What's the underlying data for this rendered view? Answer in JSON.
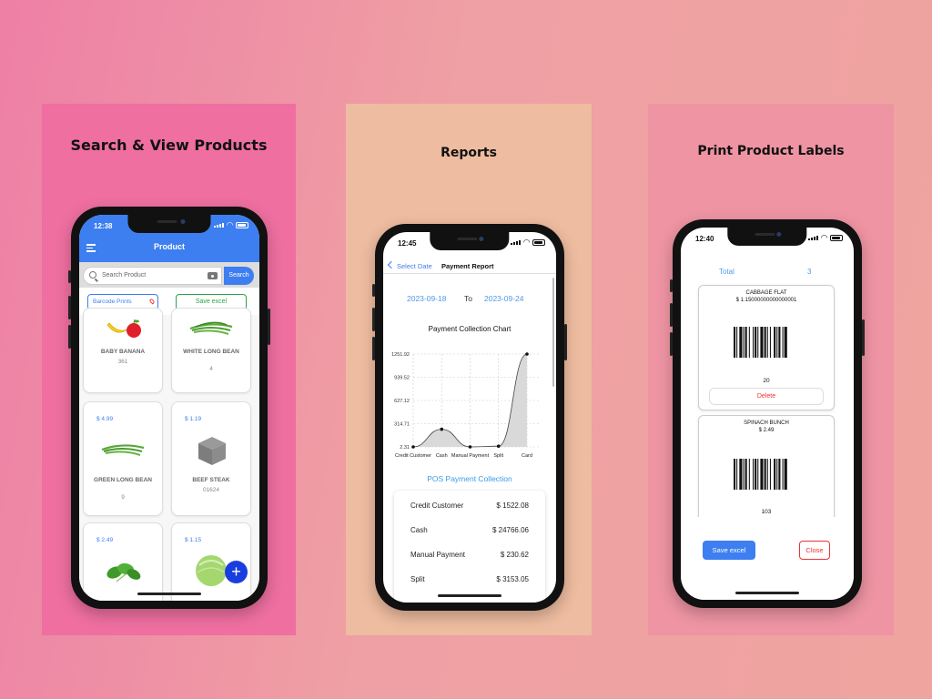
{
  "panels": {
    "search": {
      "title": "Search & View Products",
      "phone": {
        "time": "12:38",
        "header_title": "Product",
        "search_placeholder": "Search Product",
        "search_button": "Search",
        "barcode_prints": "Barcode Prints",
        "save_excel": "Save excel",
        "fab_label": "+",
        "products": [
          {
            "price": "",
            "name": "BABY BANANA",
            "code": "361",
            "image": "banana-apple"
          },
          {
            "price": "",
            "name": "WHITE LONG BEAN",
            "code": "4",
            "image": "long-bean"
          },
          {
            "price": "$ 4.99",
            "name": "GREEN LONG BEAN",
            "code": "9",
            "image": "long-bean"
          },
          {
            "price": "$ 1.19",
            "name": "BEEF STEAK",
            "code": "01624",
            "image": "box-placeholder"
          },
          {
            "price": "$ 2.49",
            "name": "",
            "code": "",
            "image": "spinach"
          },
          {
            "price": "$ 1.15",
            "name": "",
            "code": "",
            "image": "cabbage"
          }
        ]
      }
    },
    "reports": {
      "title": "Reports",
      "phone": {
        "time": "12:45",
        "back_label": "Select Date",
        "nav_title": "Payment Report",
        "date_from": "2023-09-18",
        "date_to_label": "To",
        "date_to": "2023-09-24",
        "chart_title": "Payment Collection Chart",
        "list_title": "POS Payment Collection",
        "rows": [
          {
            "label": "Credit Customer",
            "value": "$ 1522.08"
          },
          {
            "label": "Cash",
            "value": "$ 24766.06"
          },
          {
            "label": "Manual Payment",
            "value": "$ 230.62"
          },
          {
            "label": "Split",
            "value": "$ 3153.05"
          }
        ]
      }
    },
    "labels": {
      "title": "Print Product Labels",
      "phone": {
        "time": "12:40",
        "total_label": "Total",
        "total_value": "3",
        "cards": [
          {
            "name": "CABBAGE FLAT",
            "price": "$ 1.15000000000000001",
            "qty": "20",
            "delete": "Delete"
          },
          {
            "name": "SPINACH BUNCH",
            "price": "$ 2.49",
            "qty": "103",
            "delete": ""
          }
        ],
        "save_excel": "Save excel",
        "close": "Close"
      }
    }
  },
  "chart_data": {
    "type": "area",
    "title": "Payment Collection Chart",
    "categories": [
      "Credit Customer",
      "Cash",
      "Manual Payment",
      "Split",
      "Card"
    ],
    "yticks": [
      "2.31",
      "314.71",
      "627.12",
      "939.52",
      "1251.92"
    ],
    "ylim": [
      2.31,
      1251.92
    ],
    "values": [
      2.31,
      240,
      2.31,
      12,
      1251.92
    ],
    "grid": true
  },
  "colors": {
    "primary_blue": "#3d7ef0",
    "fab_blue": "#1a3de0",
    "green": "#2aa24a",
    "red": "#e33333",
    "date_blue": "#4d9ae6"
  }
}
